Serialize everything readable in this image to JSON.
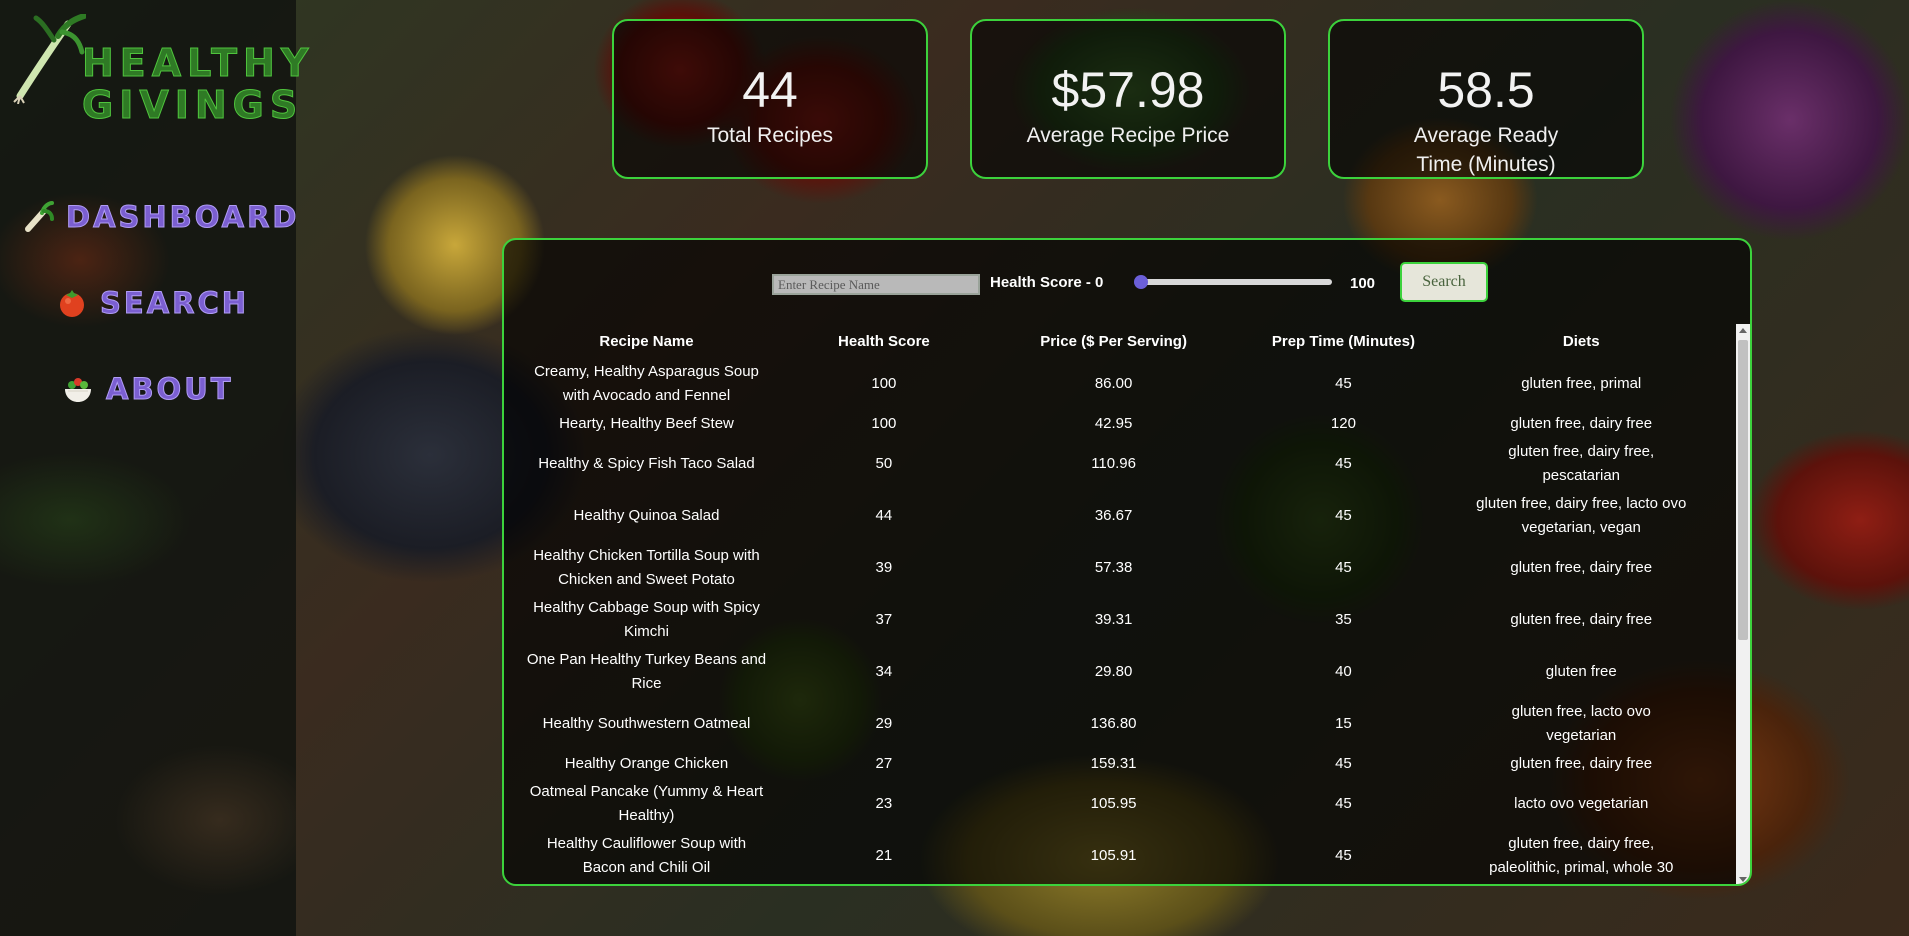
{
  "brand": {
    "name_line1": "Healthy",
    "name_line2": "Givings",
    "icon": "leek-icon"
  },
  "nav": {
    "items": [
      {
        "label": "Dashboard",
        "icon": "vegetable-icon"
      },
      {
        "label": "Search",
        "icon": "tomato-icon"
      },
      {
        "label": "About",
        "icon": "salad-bowl-icon"
      }
    ]
  },
  "stats": [
    {
      "value": "44",
      "label": "Total Recipes"
    },
    {
      "value": "$57.98",
      "label": "Average Recipe Price"
    },
    {
      "value": "58.5",
      "label": "Average Ready Time (Minutes)"
    }
  ],
  "search": {
    "placeholder": "Enter Recipe Name",
    "value": "",
    "health_score_label": "Health Score - 0",
    "slider_min": 0,
    "slider_max_label": "100",
    "button_label": "Search"
  },
  "table": {
    "columns": [
      "Recipe Name",
      "Health Score",
      "Price ($ Per Serving)",
      "Prep Time (Minutes)",
      "Diets"
    ],
    "rows": [
      [
        "Creamy, Healthy Asparagus Soup with Avocado and Fennel",
        "100",
        "86.00",
        "45",
        "gluten free, primal"
      ],
      [
        "Hearty, Healthy Beef Stew",
        "100",
        "42.95",
        "120",
        "gluten free, dairy free"
      ],
      [
        "Healthy & Spicy Fish Taco Salad",
        "50",
        "110.96",
        "45",
        "gluten free, dairy free, pescatarian"
      ],
      [
        "Healthy Quinoa Salad",
        "44",
        "36.67",
        "45",
        "gluten free, dairy free, lacto ovo vegetarian, vegan"
      ],
      [
        "Healthy Chicken Tortilla Soup with Chicken and Sweet Potato",
        "39",
        "57.38",
        "45",
        "gluten free, dairy free"
      ],
      [
        "Healthy Cabbage Soup with Spicy Kimchi",
        "37",
        "39.31",
        "35",
        "gluten free, dairy free"
      ],
      [
        "One Pan Healthy Turkey Beans and Rice",
        "34",
        "29.80",
        "40",
        "gluten free"
      ],
      [
        "Healthy Southwestern Oatmeal",
        "29",
        "136.80",
        "15",
        "gluten free, lacto ovo vegetarian"
      ],
      [
        "Healthy Orange Chicken",
        "27",
        "159.31",
        "45",
        "gluten free, dairy free"
      ],
      [
        "Oatmeal Pancake (Yummy & Heart Healthy)",
        "23",
        "105.95",
        "45",
        "lacto ovo vegetarian"
      ],
      [
        "Healthy Cauliflower Soup with Bacon and Chili Oil",
        "21",
        "105.91",
        "45",
        "gluten free, dairy free, paleolithic, primal, whole 30"
      ]
    ]
  },
  "colors": {
    "accent_green": "#3cd23c",
    "nav_purple": "#7b5fd1",
    "logo_green": "#2f7a25"
  }
}
